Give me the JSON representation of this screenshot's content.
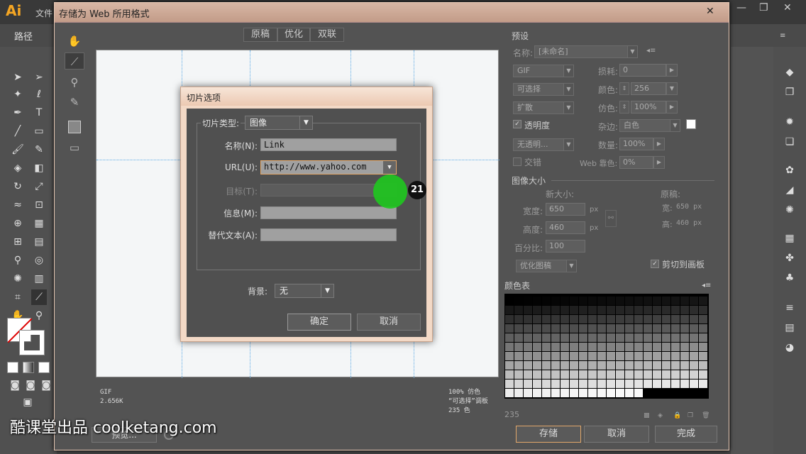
{
  "app": {
    "logo": "Ai",
    "menu_file": "文件",
    "control_label": "路径",
    "window_min": "—",
    "window_max": "❐",
    "window_close": "✕"
  },
  "dialog": {
    "title": "存储为 Web 所用格式",
    "tabs": [
      "原稿",
      "优化",
      "双联"
    ],
    "canvas_info_left": [
      "GIF",
      "2.656K"
    ],
    "canvas_info_right": [
      "100% 仿色",
      "“可选择”调板",
      "235 色"
    ],
    "preview_button": "预览...",
    "preset": {
      "section": "预设",
      "name_label": "名称:",
      "name_value": "[未命名]",
      "format": "GIF",
      "lossy_label": "损耗:",
      "lossy_value": "0",
      "reduction": "可选择",
      "colors_label": "颜色:",
      "colors_value": "256",
      "dither_algo": "扩散",
      "dither_label": "仿色:",
      "dither_value": "100%",
      "transparency_label": "透明度",
      "matte_label": "杂边:",
      "matte_value": "白色",
      "trans_dither": "无透明...",
      "amount_label": "数量:",
      "amount_value": "100%",
      "interlace_label": "交错",
      "websnap_label": "Web 靠色:",
      "websnap_value": "0%"
    },
    "image_size": {
      "section": "图像大小",
      "new_size": "新大小:",
      "width_label": "宽度:",
      "width_value": "650",
      "height_label": "高度:",
      "height_value": "460",
      "percent_label": "百分比:",
      "percent_value": "100",
      "px": "px",
      "original": "原稿:",
      "orig_w_label": "宽:",
      "orig_w": "650 px",
      "orig_h_label": "高:",
      "orig_h": "460 px",
      "quality": "优化图稿",
      "clip_label": "剪切到画板"
    },
    "color_table": {
      "section": "颜色表",
      "count": "235"
    },
    "buttons": {
      "save": "存储",
      "cancel": "取消",
      "done": "完成"
    }
  },
  "slice_options": {
    "title": "切片选项",
    "type_label": "切片类型:",
    "type_value": "图像",
    "name_label": "名称(N):",
    "name_value": "Link",
    "url_label": "URL(U):",
    "url_value": "http://www.yahoo.com",
    "target_label": "目标(T):",
    "target_value": "",
    "message_label": "信息(M):",
    "message_value": "",
    "alt_label": "替代文本(A):",
    "alt_value": "",
    "bg_label": "背景:",
    "bg_value": "无",
    "ok": "确定",
    "cancel": "取消"
  },
  "overlay": {
    "step_badge": "21",
    "watermark": "酷课堂出品 coolketang.com"
  },
  "colors": {
    "accent_orange": "#e2a76a",
    "cursor_green": "#1ec81e",
    "guide_blue": "#5aa9e6"
  }
}
